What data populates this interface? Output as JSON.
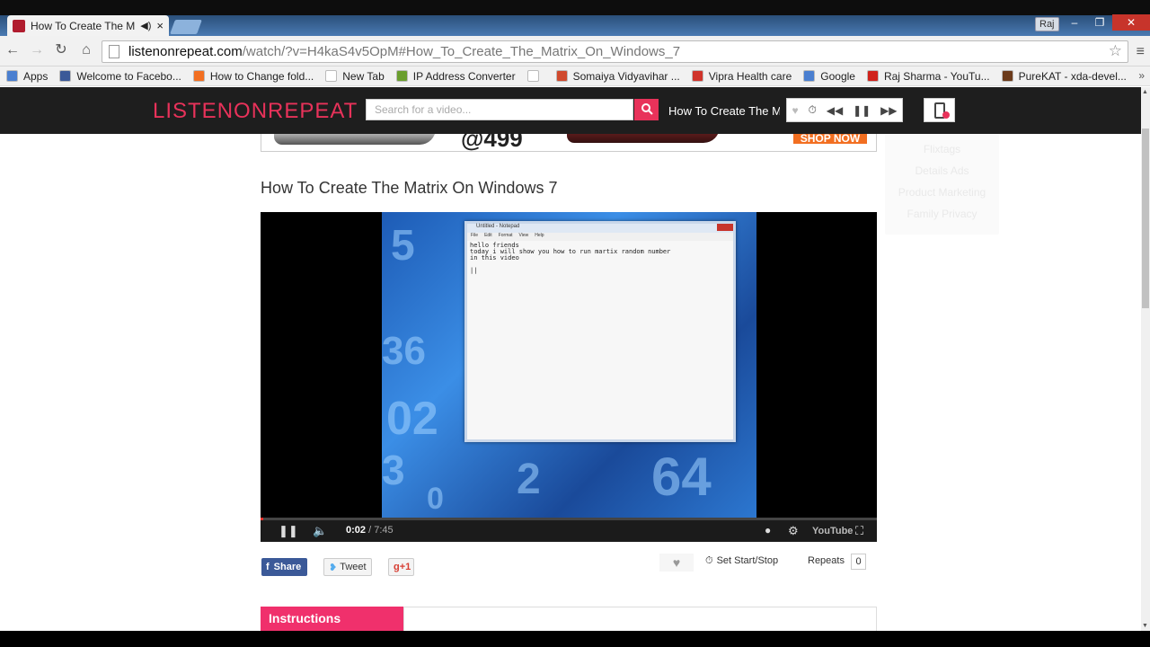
{
  "browser": {
    "tab_title": "How To Create The M",
    "tab_close": "×",
    "tab_audio": "◀)",
    "profile": "Raj",
    "window_buttons": [
      "–",
      "❐",
      "✕"
    ],
    "nav": {
      "back": "←",
      "forward": "→",
      "reload": "↻",
      "home": "⌂"
    },
    "url_host": "listenonrepeat.com",
    "url_path": "/watch/?v=H4kaS4v5OpM#How_To_Create_The_Matrix_On_Windows_7",
    "star": "☆",
    "menu": "≡"
  },
  "bookmarks": [
    {
      "label": "Apps",
      "color": "#4a7fd0"
    },
    {
      "label": "Welcome to Facebo...",
      "color": "#3b5998"
    },
    {
      "label": "How to Change fold...",
      "color": "#f26f21"
    },
    {
      "label": "New Tab",
      "color": "#ffffff"
    },
    {
      "label": "IP Address Converter",
      "color": "#6a9e2e"
    },
    {
      "label": "",
      "color": "#ffffff"
    },
    {
      "label": "Somaiya Vidyavihar ...",
      "color": "#d04a2e"
    },
    {
      "label": "Vipra Health care",
      "color": "#d0342b"
    },
    {
      "label": "Google",
      "color": "#4a7fd0"
    },
    {
      "label": "Raj Sharma - YouTu...",
      "color": "#d0221b"
    },
    {
      "label": "PureKAT - xda-devel...",
      "color": "#6b3a1a"
    }
  ],
  "bookmarks_more": "»",
  "site": {
    "logo": "LISTENONREPEAT",
    "search_placeholder": "Search for a video...",
    "search_icon": "🔍",
    "now_playing": "How To Create The Matrix On Windows 7",
    "controls": [
      "♥",
      "⏱",
      "◀◀",
      "❚❚",
      "▶▶"
    ]
  },
  "ad": {
    "price": "@499",
    "cta": "SHOP NOW",
    "side_text": [
      "Flixtags",
      "Details Ads",
      "Product Marketing",
      "Family Privacy"
    ]
  },
  "video": {
    "title": "How To Create The Matrix On Windows 7",
    "notepad_title": "Untitled - Notepad",
    "notepad_menu": [
      "File",
      "Edit",
      "Format",
      "View",
      "Help"
    ],
    "notepad_text": "hello friends\ntoday i will show you how to run martix random number\nin this video\n\n||",
    "time_current": "0:02",
    "time_sep": " / ",
    "time_duration": "7:45",
    "progress_fraction": 0.0045,
    "icons": [
      "pause-icon",
      "volume-icon",
      "info-icon",
      "settings-icon",
      "fullscreen-icon"
    ],
    "youtube_logo": "YouTube"
  },
  "social": {
    "share": "Share",
    "tweet": "Tweet",
    "gplus": "g+1"
  },
  "actions": {
    "heart": "♥",
    "set_start_stop": "Set Start/Stop",
    "repeats_label": "Repeats",
    "repeats_count": "0"
  },
  "instructions": {
    "tab": "Instructions"
  },
  "colors": {
    "accent": "#e8325a",
    "facebook": "#3b5998"
  }
}
